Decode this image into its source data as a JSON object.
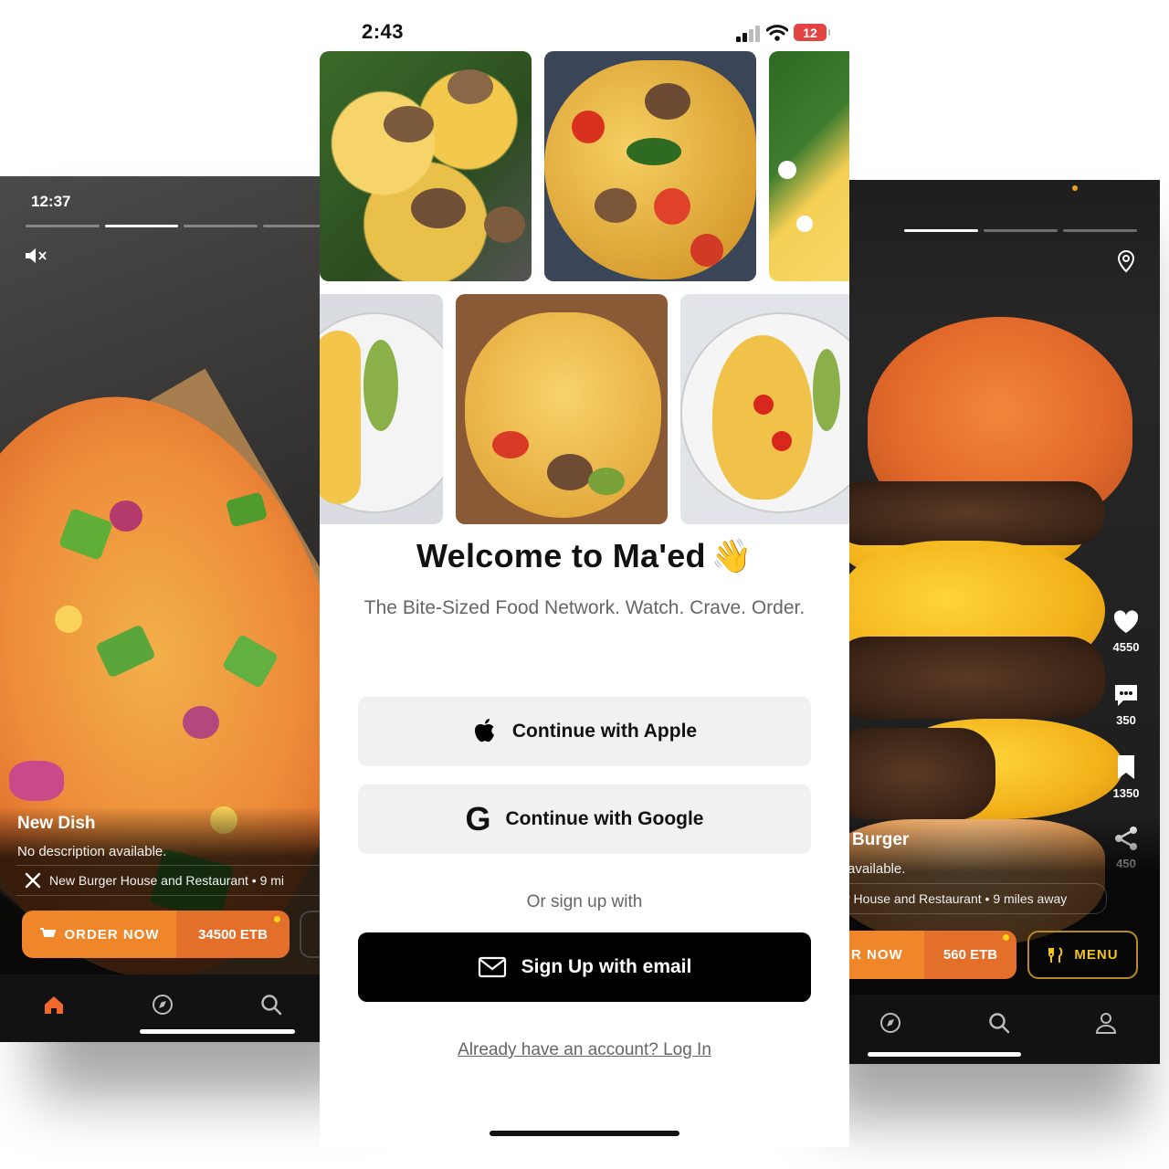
{
  "left_screen": {
    "status_time": "12:37",
    "dish_name": "New Dish",
    "dish_description": "No description available.",
    "restaurant_line": "New Burger House and Restaurant • 9 mi",
    "order_label": "ORDER NOW",
    "price": "34500 ETB",
    "tabs": [
      "home-icon",
      "compass-icon",
      "search-icon"
    ]
  },
  "center_screen": {
    "status": {
      "time": "2:43",
      "battery": "12"
    },
    "title": "Welcome to Ma'ed",
    "title_emoji": "👋",
    "tagline": "The Bite-Sized Food Network. Watch. Crave. Order.",
    "apple_button": "Continue with Apple",
    "google_button": "Continue with Google",
    "google_glyph": "G",
    "or_label": "Or sign up with",
    "email_button": "Sign Up with email",
    "login_link": "Already have an account? Log In"
  },
  "right_screen": {
    "dish_name": "Burger",
    "dish_description": "available.",
    "restaurant_line": "r House and Restaurant • 9 miles away",
    "order_label": "R NOW",
    "price": "560 ETB",
    "menu_label": "MENU",
    "likes": "4550",
    "comments": "350",
    "saves": "1350",
    "shares": "450",
    "tabs": [
      "compass-icon",
      "search-icon",
      "profile-icon"
    ]
  },
  "colors": {
    "order_orange": "#f0862a",
    "price_orange": "#e46f2a",
    "menu_gold": "#f3c31e",
    "battery_red": "#e34545",
    "home_tab_active": "#f26a2b"
  }
}
